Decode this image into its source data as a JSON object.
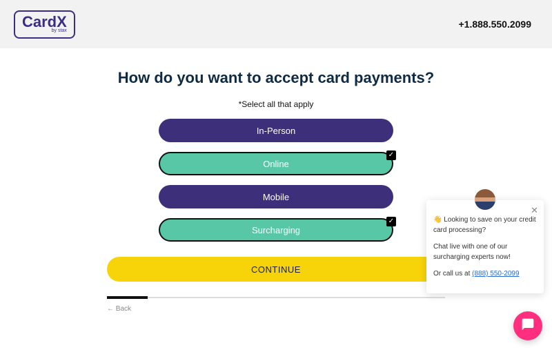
{
  "header": {
    "logo_main": "CardX",
    "logo_sub": "by stax",
    "phone": "+1.888.550.2099"
  },
  "form": {
    "title": "How do you want to accept card payments?",
    "subtitle": "*Select all that apply",
    "options": [
      {
        "label": "In-Person",
        "selected": false
      },
      {
        "label": "Online",
        "selected": true
      },
      {
        "label": "Mobile",
        "selected": false
      },
      {
        "label": "Surcharging",
        "selected": true
      }
    ],
    "continue_label": "CONTINUE",
    "progress_percent": 12,
    "back_label": "← Back"
  },
  "chat": {
    "greeting_emoji": "👋",
    "line1": "Looking to save on your credit card processing?",
    "line2": "Chat live with one of our surcharging experts now!",
    "line3_prefix": "Or call us at ",
    "line3_link": "(888) 550-2099"
  }
}
